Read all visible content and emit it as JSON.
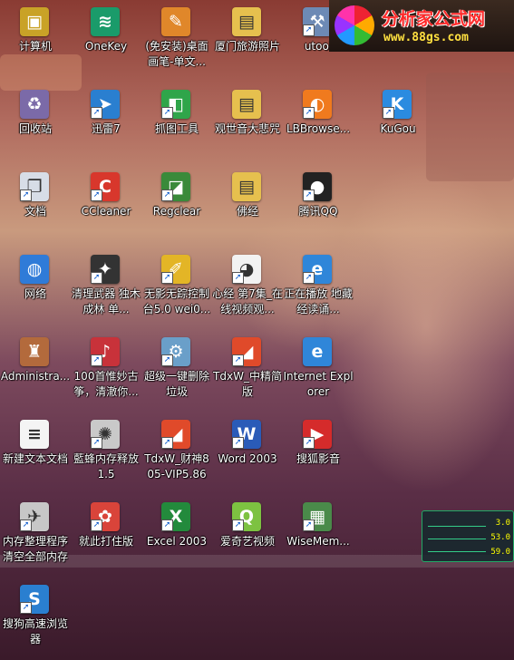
{
  "banner": {
    "title": "分析家公式网",
    "url": "www.88gs.com"
  },
  "gadget": {
    "values": [
      "3.0",
      "53.0",
      "59.0"
    ]
  },
  "colors": {
    "banner_title": "#ff2a2a",
    "banner_url": "#ffe040",
    "label_text": "#ffffff"
  },
  "desktop": {
    "icons": [
      {
        "label": "计算机",
        "icon": "computer-icon",
        "glyph": "▣",
        "color": "#c9a227",
        "shortcut": false
      },
      {
        "label": "OneKey",
        "icon": "onekey-icon",
        "glyph": "≋",
        "color": "#1a9b6a",
        "shortcut": false
      },
      {
        "label": "(免安装)桌面画笔-单文...",
        "icon": "paint-palette-icon",
        "glyph": "✎",
        "color": "#e0872a",
        "shortcut": false
      },
      {
        "label": "厦门旅游照片",
        "icon": "folder-icon",
        "glyph": "▤",
        "color": "#e6c04e",
        "shortcut": false
      },
      {
        "label": "utool",
        "icon": "utool-icon",
        "glyph": "⚒",
        "color": "#6d8ab5",
        "shortcut": true
      },
      {
        "label": "回收站",
        "icon": "recycle-bin-icon",
        "glyph": "♻",
        "color": "#7b6aa8",
        "shortcut": false
      },
      {
        "label": "迅雷7",
        "icon": "thunder-icon",
        "glyph": "➤",
        "color": "#2a7fd0",
        "shortcut": true
      },
      {
        "label": "抓图工具",
        "icon": "screenshot-tool-icon",
        "glyph": "◧",
        "color": "#2fa54a",
        "shortcut": true
      },
      {
        "label": "观世音大悲咒",
        "icon": "folder-icon",
        "glyph": "▤",
        "color": "#e6c04e",
        "shortcut": false
      },
      {
        "label": "LBBrowse...",
        "icon": "liebao-browser-icon",
        "glyph": "◐",
        "color": "#f07a1e",
        "shortcut": true
      },
      {
        "label": "KuGou",
        "icon": "kugou-icon",
        "glyph": "K",
        "color": "#2b8be0",
        "shortcut": true
      },
      {
        "label": "文档",
        "icon": "documents-icon",
        "glyph": "❐",
        "color": "#d7dde7",
        "shortcut": true
      },
      {
        "label": "CCleaner",
        "icon": "ccleaner-icon",
        "glyph": "C",
        "color": "#d8372c",
        "shortcut": true
      },
      {
        "label": "Regclear",
        "icon": "regclear-icon",
        "glyph": "◪",
        "color": "#3a8a3a",
        "shortcut": true
      },
      {
        "label": "佛经",
        "icon": "folder-icon",
        "glyph": "▤",
        "color": "#e6c04e",
        "shortcut": false
      },
      {
        "label": "腾讯QQ",
        "icon": "qq-icon",
        "glyph": "●",
        "color": "#222222",
        "shortcut": true
      },
      {
        "label": "网络",
        "icon": "network-icon",
        "glyph": "◍",
        "color": "#2f7bd8",
        "shortcut": false
      },
      {
        "label": "清理武器 独木成林 单...",
        "icon": "clean-weapon-icon",
        "glyph": "✦",
        "color": "#333333",
        "shortcut": true
      },
      {
        "label": "无影无踪控制台5.0 wei0...",
        "icon": "broom-icon",
        "glyph": "✐",
        "color": "#e3b526",
        "shortcut": true
      },
      {
        "label": "心经 第7集_在线视频观...",
        "icon": "web-page-icon",
        "glyph": "◕",
        "color": "#f2f2f2",
        "shortcut": true
      },
      {
        "label": "正在播放 地藏经读诵...",
        "icon": "internet-explorer-icon",
        "glyph": "e",
        "color": "#2f86d9",
        "shortcut": true
      },
      {
        "label": "Administra...",
        "icon": "user-folder-icon",
        "glyph": "♜",
        "color": "#b36a3c",
        "shortcut": false
      },
      {
        "label": "100首惟妙古筝，清澈你...",
        "icon": "album-cover-icon",
        "glyph": "♪",
        "color": "#c8323a",
        "shortcut": true
      },
      {
        "label": "超级一键删除垃圾",
        "icon": "settings-gear-icon",
        "glyph": "⚙",
        "color": "#6a9fc9",
        "shortcut": true
      },
      {
        "label": "TdxW_中精简版",
        "icon": "tdx-icon",
        "glyph": "◢",
        "color": "#e04a2a",
        "shortcut": true
      },
      {
        "label": "Internet Explorer",
        "icon": "internet-explorer-icon",
        "glyph": "e",
        "color": "#2f86d9",
        "shortcut": false
      },
      {
        "label": "新建文本文档",
        "icon": "text-document-icon",
        "glyph": "≡",
        "color": "#f4f4f4",
        "shortcut": false
      },
      {
        "label": "藍蜂内存释放1.5",
        "icon": "bee-icon",
        "glyph": "✺",
        "color": "#c9c9c9",
        "shortcut": true
      },
      {
        "label": "TdxW_财神805-VIP5.86",
        "icon": "tdx-icon",
        "glyph": "◢",
        "color": "#e04a2a",
        "shortcut": true
      },
      {
        "label": "Word 2003",
        "icon": "word-icon",
        "glyph": "W",
        "color": "#2a5bb8",
        "shortcut": true
      },
      {
        "label": "搜狐影音",
        "icon": "sohu-video-icon",
        "glyph": "▶",
        "color": "#d52b2b",
        "shortcut": true
      },
      {
        "label": "内存整理程序清空全部内存",
        "icon": "rocket-icon",
        "glyph": "✈",
        "color": "#c7c7c7",
        "shortcut": true
      },
      {
        "label": "就此打住版",
        "icon": "photo-icon",
        "glyph": "✿",
        "color": "#d9443a",
        "shortcut": true
      },
      {
        "label": "Excel 2003",
        "icon": "excel-icon",
        "glyph": "X",
        "color": "#238a3c",
        "shortcut": true
      },
      {
        "label": "爱奇艺视频",
        "icon": "iqiyi-icon",
        "glyph": "Q",
        "color": "#7dc241",
        "shortcut": true
      },
      {
        "label": "WiseMem...",
        "icon": "wisememory-icon",
        "glyph": "▦",
        "color": "#4a8a4a",
        "shortcut": true
      },
      {
        "label": "搜狗高速浏览器",
        "icon": "sogou-browser-icon",
        "glyph": "S",
        "color": "#2a7fd0",
        "shortcut": true
      }
    ]
  }
}
